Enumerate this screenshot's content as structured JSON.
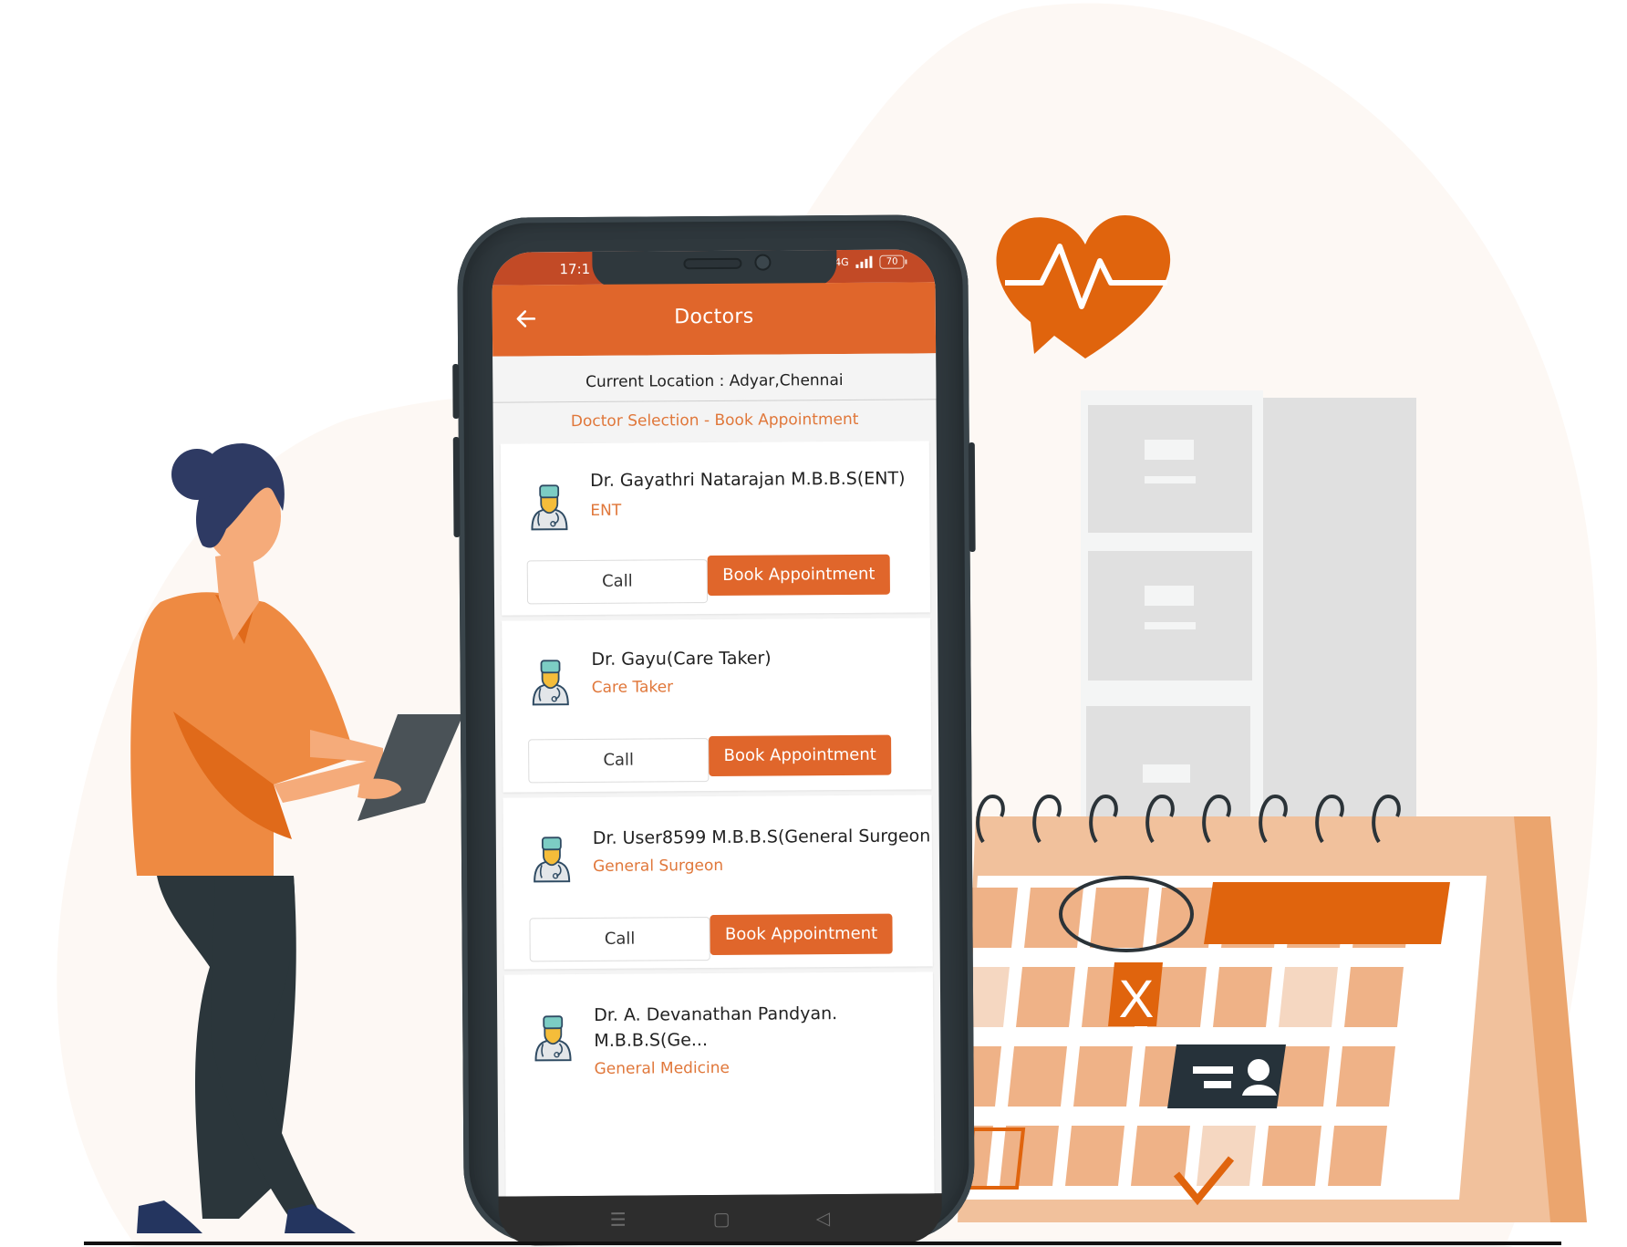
{
  "status_bar": {
    "time": "17:1",
    "network": "4G",
    "battery": "70"
  },
  "app_bar": {
    "title": "Doctors",
    "back_icon": "arrow-left-icon"
  },
  "location": {
    "text": "Current Location : Adyar,Chennai"
  },
  "section_title": "Doctor Selection - Book Appointment",
  "doctors": [
    {
      "name": "Dr. Gayathri Natarajan M.B.B.S(ENT)",
      "specialty": "ENT",
      "call_label": "Call",
      "book_label": "Book Appointment"
    },
    {
      "name": "Dr. Gayu(Care Taker)",
      "specialty": "Care Taker",
      "call_label": "Call",
      "book_label": "Book Appointment"
    },
    {
      "name": "Dr. User8599 M.B.B.S(General Surgeon",
      "specialty": "General Surgeon",
      "call_label": "Call",
      "book_label": "Book Appointment"
    },
    {
      "name_line1": "Dr. A. Devanathan Pandyan.",
      "name_line2": "M.B.B.S(Ge...",
      "specialty": "General Medicine"
    }
  ],
  "nav_bar": {
    "menu_glyph": "☰",
    "home_glyph": "▢",
    "back_glyph": "◁"
  },
  "calendar": {
    "x_mark": "X"
  },
  "colors": {
    "brand_orange": "#e0662b",
    "status_bar": "#c24a26",
    "specialty_text": "#e0773a",
    "phone_body": "#2f383d",
    "calendar_cell": "#efb287",
    "calendar_light_cell": "#f5d7c1",
    "calendar_frame": "#f1c19c",
    "background_blob": "#fdf8f4"
  }
}
